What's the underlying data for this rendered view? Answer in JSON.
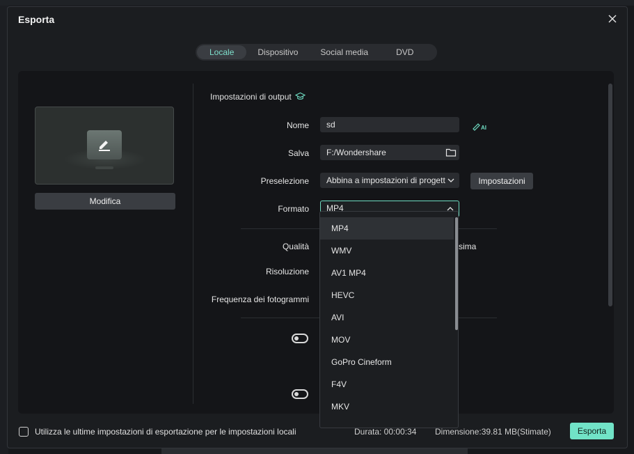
{
  "dialog": {
    "title": "Esporta"
  },
  "tabs": [
    {
      "label": "Locale",
      "active": true
    },
    {
      "label": "Dispositivo"
    },
    {
      "label": "Social media"
    },
    {
      "label": "DVD"
    }
  ],
  "preview": {
    "edit_label": "Modifica",
    "icon": "pencil-icon"
  },
  "output": {
    "section_title": "Impostazioni di output",
    "section_icon": "graduation-cap-icon",
    "name_label": "Nome",
    "name_value": "sd",
    "save_label": "Salva",
    "save_value": "F:/Wondershare",
    "preset_label": "Preselezione",
    "preset_value": "Abbina a impostazioni di progetto",
    "settings_button": "Impostazioni",
    "format_label": "Formato",
    "format_value": "MP4",
    "quality_label": "Qualità",
    "quality_tail": "sima",
    "resolution_label": "Risoluzione",
    "fps_label": "Frequenza dei fotogrammi"
  },
  "format_options": [
    "MP4",
    "WMV",
    "AV1 MP4",
    "HEVC",
    "AVI",
    "MOV",
    "GoPro Cineform",
    "F4V",
    "MKV"
  ],
  "footer": {
    "checkbox_label": "Utilizza le ultime impostazioni di esportazione per le impostazioni locali",
    "duration": "Durata: 00:00:34",
    "size": "Dimensione:39.81 MB(Stimate)",
    "export_button": "Esporta"
  },
  "colors": {
    "accent": "#71e3c7",
    "panel": "#141518",
    "dialog": "#1b1d20"
  }
}
